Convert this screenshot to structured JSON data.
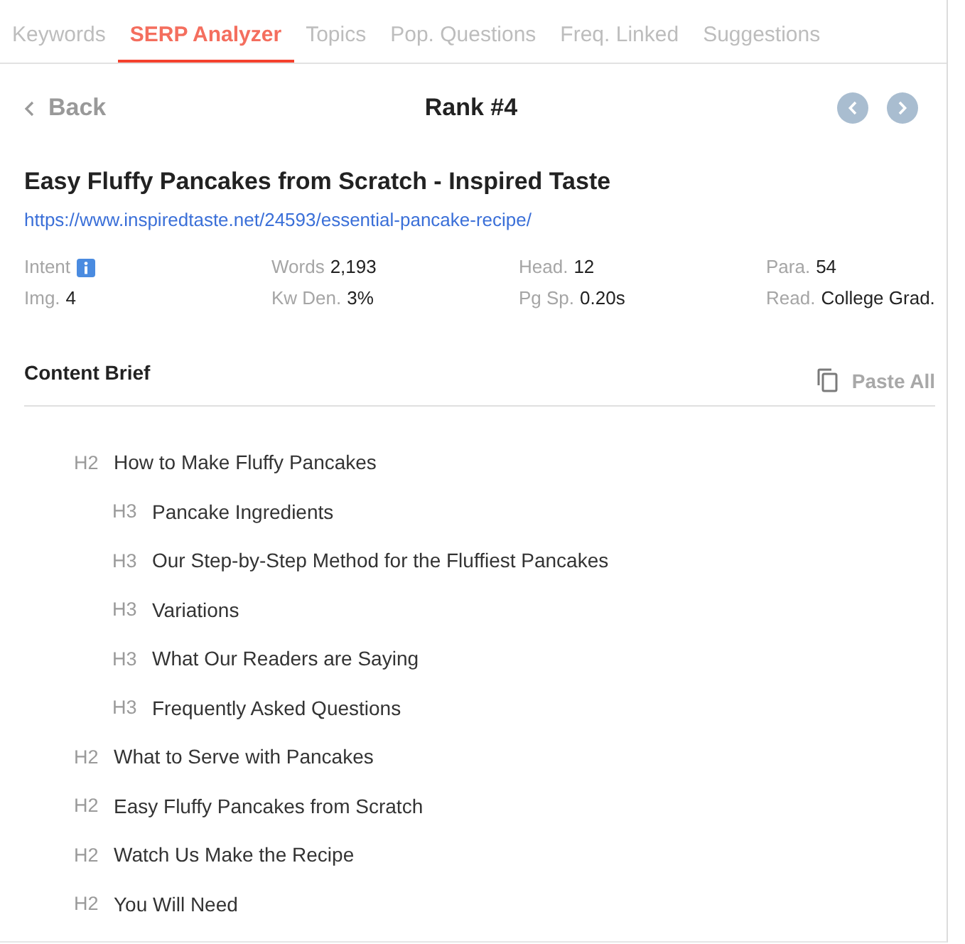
{
  "tabs": [
    {
      "label": "Keywords",
      "selected": false
    },
    {
      "label": "SERP Analyzer",
      "selected": true
    },
    {
      "label": "Topics",
      "selected": false
    },
    {
      "label": "Pop. Questions",
      "selected": false
    },
    {
      "label": "Freq. Linked",
      "selected": false
    },
    {
      "label": "Suggestions",
      "selected": false
    }
  ],
  "header": {
    "back_label": "Back",
    "title": "Rank #4"
  },
  "result": {
    "title": "Easy Fluffy Pancakes from Scratch - Inspired Taste",
    "url": "https://www.inspiredtaste.net/24593/essential-pancake-recipe/",
    "metrics": [
      {
        "kind": "info",
        "label": "Intent"
      },
      {
        "kind": "value",
        "label": "Words",
        "value": "2,193"
      },
      {
        "kind": "value",
        "label": "Head.",
        "value": "12"
      },
      {
        "kind": "value",
        "label": "Para.",
        "value": "54"
      },
      {
        "kind": "value",
        "label": "Img.",
        "value": "4"
      },
      {
        "kind": "value",
        "label": "Kw Den.",
        "value": "3%"
      },
      {
        "kind": "value",
        "label": "Pg Sp.",
        "value": "0.20s"
      },
      {
        "kind": "value",
        "label": "Read.",
        "value": "College Grad."
      }
    ]
  },
  "content_brief": {
    "title": "Content Brief",
    "paste_label": "Paste All",
    "outline": [
      {
        "tag": "H2",
        "text": "How to Make Fluffy Pancakes",
        "children": [
          {
            "tag": "H3",
            "text": "Pancake Ingredients"
          },
          {
            "tag": "H3",
            "text": "Our Step-by-Step Method for the Fluffiest Pancakes"
          },
          {
            "tag": "H3",
            "text": "Variations"
          },
          {
            "tag": "H3",
            "text": "What Our Readers are Saying"
          },
          {
            "tag": "H3",
            "text": "Frequently Asked Questions"
          }
        ]
      },
      {
        "tag": "H2",
        "text": "What to Serve with Pancakes"
      },
      {
        "tag": "H2",
        "text": "Easy Fluffy Pancakes from Scratch"
      },
      {
        "tag": "H2",
        "text": "Watch Us Make the Recipe"
      },
      {
        "tag": "H2",
        "text": "You Will Need"
      }
    ]
  }
}
